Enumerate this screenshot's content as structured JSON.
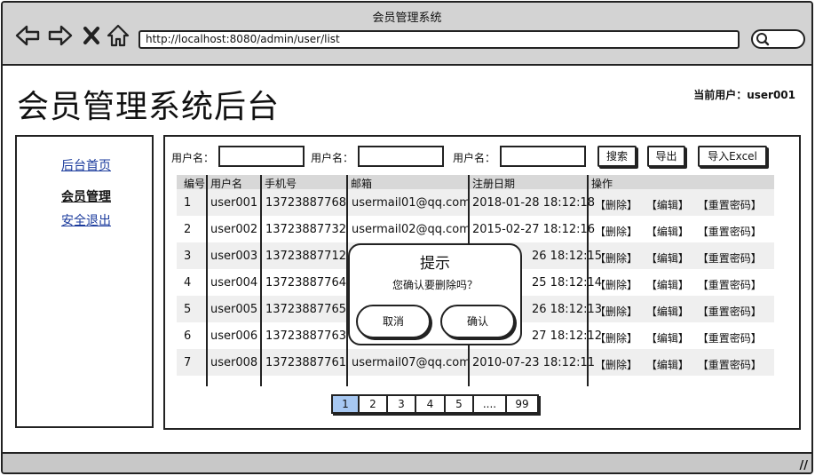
{
  "window": {
    "title": "会员管理系统"
  },
  "browser": {
    "url": "http://localhost:8080/admin/user/list",
    "icons": [
      "back-arrow-icon",
      "forward-arrow-icon",
      "close-icon",
      "home-icon",
      "search-icon"
    ]
  },
  "header": {
    "title": "会员管理系统后台",
    "current_user": "当前用户：user001"
  },
  "sidebar": {
    "items": [
      {
        "label": "后台首页",
        "active": false
      },
      {
        "label": "会员管理",
        "active": true
      },
      {
        "label": "安全退出",
        "active": false
      }
    ]
  },
  "filters": {
    "label_1": "用户名：",
    "label_2": "用户名：",
    "label_3": "用户名：",
    "value_1": "",
    "value_2": "",
    "value_3": ""
  },
  "toolbar": {
    "search": "搜索",
    "export": "导出",
    "import": "导入Excel"
  },
  "table": {
    "headers": [
      "编号",
      "用户名",
      "手机号",
      "邮箱",
      "注册日期",
      "操作"
    ],
    "rows": [
      {
        "id": "1",
        "username": "user001",
        "phone": "13723887768",
        "email": "usermail01@qq.com",
        "date": "2018-01-28 18:12:18"
      },
      {
        "id": "2",
        "username": "user002",
        "phone": "13723887732",
        "email": "usermail02@qq.com",
        "date": "2015-02-27 18:12:16"
      },
      {
        "id": "3",
        "username": "user003",
        "phone": "13723887712",
        "email": "",
        "date": "26 18:12:15"
      },
      {
        "id": "4",
        "username": "user004",
        "phone": "13723887764",
        "email": "",
        "date": "25 18:12:14"
      },
      {
        "id": "5",
        "username": "user005",
        "phone": "13723887765",
        "email": "",
        "date": "26 18:12:13"
      },
      {
        "id": "6",
        "username": "user006",
        "phone": "13723887763",
        "email": "",
        "date": "27 18:12:12"
      },
      {
        "id": "7",
        "username": "user008",
        "phone": "13723887761",
        "email": "usermail07@qq.com",
        "date": "2010-07-23 18:12:11"
      }
    ],
    "ops": {
      "delete": "【删除】",
      "edit": "【编辑】",
      "reset": "【重置密码】"
    }
  },
  "pagination": {
    "pages": [
      "1",
      "2",
      "3",
      "4",
      "5",
      "....",
      "99"
    ],
    "current": "1"
  },
  "modal": {
    "title": "提示",
    "message": "您确认要删除吗？",
    "cancel": "取消",
    "confirm": "确认"
  },
  "colors": {
    "chrome": "#d3d3d3",
    "row_stripe": "#efefef",
    "current_page": "#a7c8f2",
    "link": "#1a3a9c"
  }
}
